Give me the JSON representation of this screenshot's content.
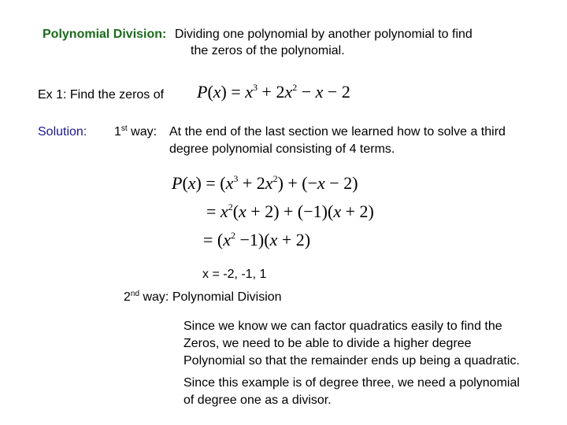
{
  "header": {
    "label": "Polynomial Division:",
    "line1": "Dividing one polynomial by another polynomial to find",
    "line2": "the zeros of the polynomial."
  },
  "example": {
    "prompt": "Ex 1:  Find the zeros of",
    "equation": {
      "lhs": "P(x) = ",
      "terms": [
        "x",
        "3",
        " + 2x",
        "2",
        " − x − 2"
      ]
    }
  },
  "solution": {
    "label": "Solution:",
    "way1": {
      "num": "1",
      "ord": "st",
      "label": " way:",
      "line1": "At the end of the last section we learned how to solve a third",
      "line2": "degree polynomial consisting of 4 terms."
    },
    "steps": [
      {
        "text_a": "P(x) = (x",
        "sup_a": "3",
        "text_b": " + 2x",
        "sup_b": "2",
        "text_c": ") + (−x − 2)"
      },
      {
        "text_a": "= x",
        "sup_a": "2",
        "text_b": "(x + 2) + (−1)(x + 2)"
      },
      {
        "text_a": "= (x",
        "sup_a": "2",
        "text_b": " −1)(x + 2)"
      }
    ],
    "zeros": "x = -2, -1, 1",
    "way2": {
      "num": "2",
      "ord": "nd",
      "label": " way:  Polynomial Division"
    },
    "paragraph1": [
      "Since we know we can factor quadratics easily to find the",
      "Zeros, we need to be able to divide a higher degree",
      "Polynomial so that the remainder ends up being a quadratic."
    ],
    "paragraph2": [
      "Since this example is of degree three, we need a polynomial",
      "of degree one as a divisor."
    ]
  },
  "colors": {
    "title_label": "#1a6b1a",
    "solution_label": "#1a1a8c",
    "text": "#000000"
  }
}
